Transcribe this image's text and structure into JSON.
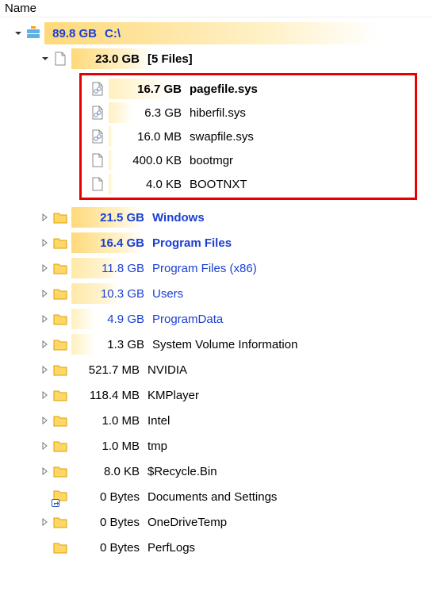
{
  "header": {
    "column_label": "Name"
  },
  "drive": {
    "size": "89.8 GB",
    "name": "C:\\"
  },
  "files_group": {
    "size": "23.0 GB",
    "label": "[5 Files]"
  },
  "files": [
    {
      "size": "16.7 GB",
      "name": "pagefile.sys",
      "bold": true,
      "sys": true
    },
    {
      "size": "6.3 GB",
      "name": "hiberfil.sys",
      "bold": false,
      "sys": true
    },
    {
      "size": "16.0 MB",
      "name": "swapfile.sys",
      "bold": false,
      "sys": true
    },
    {
      "size": "400.0 KB",
      "name": "bootmgr",
      "bold": false,
      "sys": false
    },
    {
      "size": "4.0 KB",
      "name": "BOOTNXT",
      "bold": false,
      "sys": false
    }
  ],
  "folders": [
    {
      "size": "21.5 GB",
      "name": "Windows",
      "bold": true,
      "blue": true,
      "shade": "orange",
      "shortcut": false
    },
    {
      "size": "16.4 GB",
      "name": "Program Files",
      "bold": true,
      "blue": true,
      "shade": "orange",
      "shortcut": false
    },
    {
      "size": "11.8 GB",
      "name": "Program Files (x86)",
      "bold": false,
      "blue": true,
      "shade": "yellow",
      "shortcut": false
    },
    {
      "size": "10.3 GB",
      "name": "Users",
      "bold": false,
      "blue": true,
      "shade": "yellow",
      "shortcut": false
    },
    {
      "size": "4.9 GB",
      "name": "ProgramData",
      "bold": false,
      "blue": true,
      "shade": "pale",
      "shortcut": false
    },
    {
      "size": "1.3 GB",
      "name": "System Volume Information",
      "bold": false,
      "blue": false,
      "shade": "pale",
      "shortcut": false
    },
    {
      "size": "521.7 MB",
      "name": "NVIDIA",
      "bold": false,
      "blue": false,
      "shade": "none",
      "shortcut": false
    },
    {
      "size": "118.4 MB",
      "name": "KMPlayer",
      "bold": false,
      "blue": false,
      "shade": "none",
      "shortcut": false
    },
    {
      "size": "1.0 MB",
      "name": "Intel",
      "bold": false,
      "blue": false,
      "shade": "none",
      "shortcut": false
    },
    {
      "size": "1.0 MB",
      "name": "tmp",
      "bold": false,
      "blue": false,
      "shade": "none",
      "shortcut": false
    },
    {
      "size": "8.0 KB",
      "name": "$Recycle.Bin",
      "bold": false,
      "blue": false,
      "shade": "none",
      "shortcut": false
    },
    {
      "size": "0 Bytes",
      "name": "Documents and Settings",
      "bold": false,
      "blue": false,
      "shade": "none",
      "shortcut": true
    },
    {
      "size": "0 Bytes",
      "name": "OneDriveTemp",
      "bold": false,
      "blue": false,
      "shade": "none",
      "shortcut": false
    },
    {
      "size": "0 Bytes",
      "name": "PerfLogs",
      "bold": false,
      "blue": false,
      "shade": "none",
      "shortcut": false
    }
  ]
}
